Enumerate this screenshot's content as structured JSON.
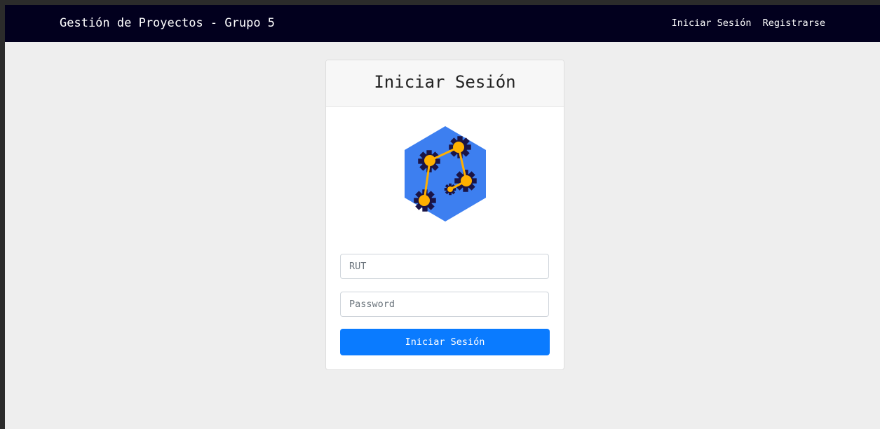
{
  "navbar": {
    "brand": "Gestión de Proyectos - Grupo 5",
    "links": [
      "Iniciar Sesión",
      "Registrarse"
    ]
  },
  "login": {
    "title": "Iniciar Sesión",
    "rut_placeholder": "RUT",
    "password_placeholder": "Password",
    "submit_label": "Iniciar Sesión"
  },
  "colors": {
    "navbar": "#02001e",
    "page": "#eeeeee",
    "button": "#0a7bff",
    "logo_hex": "#3d7ff0",
    "logo_gear": "#1a1446",
    "logo_node": "#ffb000"
  },
  "icons": {
    "logo": "hexagon-gears-network-icon"
  }
}
